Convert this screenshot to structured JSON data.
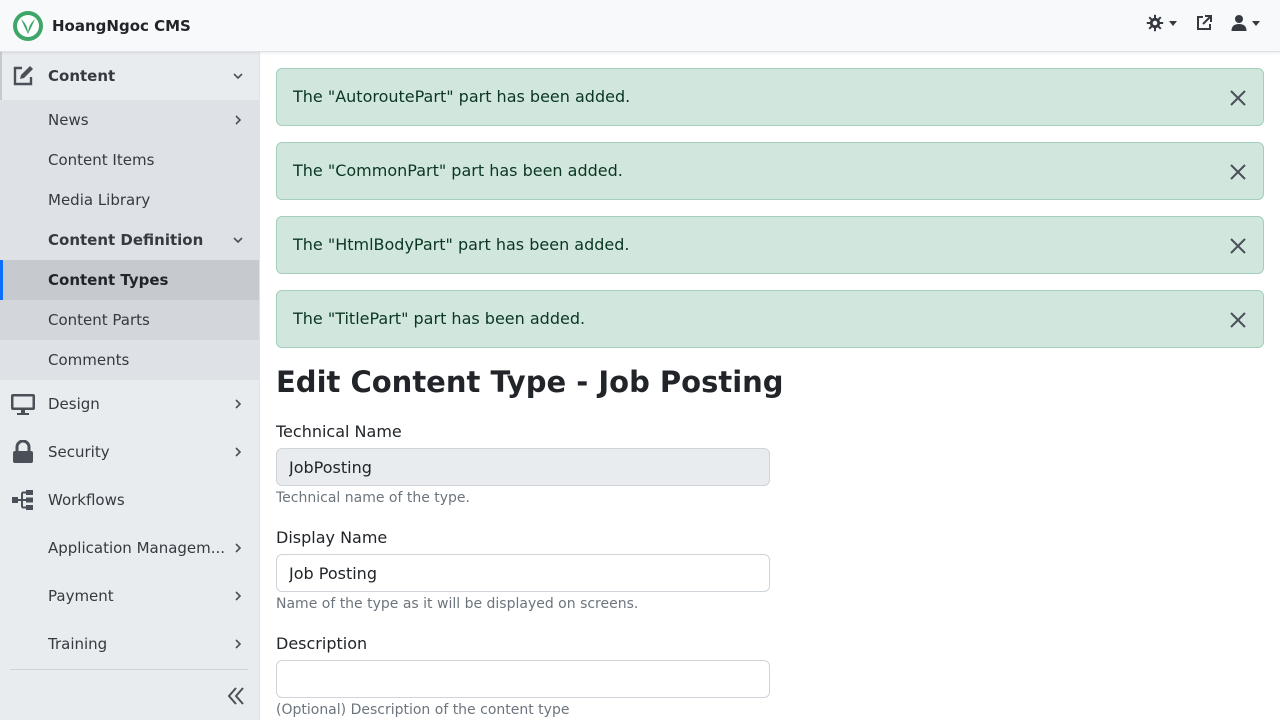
{
  "app": {
    "title": "HoangNgoc CMS"
  },
  "header": {
    "theme_button_icon": "gear-icon",
    "visit_site_icon": "external-link-icon",
    "user_menu_icon": "user-icon"
  },
  "sidebar": {
    "content": {
      "label": "Content",
      "icon": "edit-icon"
    },
    "news": {
      "label": "News"
    },
    "content_items": {
      "label": "Content Items"
    },
    "media_library": {
      "label": "Media Library"
    },
    "content_definition": {
      "label": "Content Definition"
    },
    "content_types": {
      "label": "Content Types"
    },
    "content_parts": {
      "label": "Content Parts"
    },
    "comments": {
      "label": "Comments"
    },
    "design": {
      "label": "Design",
      "icon": "monitor-icon"
    },
    "security": {
      "label": "Security",
      "icon": "lock-icon"
    },
    "workflows": {
      "label": "Workflows",
      "icon": "sitemap-icon"
    },
    "application_management": {
      "label": "Application Managem..."
    },
    "payment": {
      "label": "Payment"
    },
    "training": {
      "label": "Training"
    },
    "collapse_icon": "double-chevron-left-icon"
  },
  "alerts": [
    {
      "text": "The \"AutoroutePart\" part has been added."
    },
    {
      "text": "The \"CommonPart\" part has been added."
    },
    {
      "text": "The \"HtmlBodyPart\" part has been added."
    },
    {
      "text": "The \"TitlePart\" part has been added."
    }
  ],
  "form": {
    "title": "Edit Content Type - Job Posting",
    "technical_name": {
      "label": "Technical Name",
      "value": "JobPosting",
      "help": "Technical name of the type."
    },
    "display_name": {
      "label": "Display Name",
      "value": "Job Posting",
      "help": "Name of the type as it will be displayed on screens."
    },
    "description": {
      "label": "Description",
      "value": "",
      "help": "(Optional) Description of the content type"
    }
  },
  "colors": {
    "accent": "#0d6efd",
    "alert_bg": "#d1e7dd",
    "alert_text": "#0a3622",
    "brand_green": "#3fa66a"
  }
}
